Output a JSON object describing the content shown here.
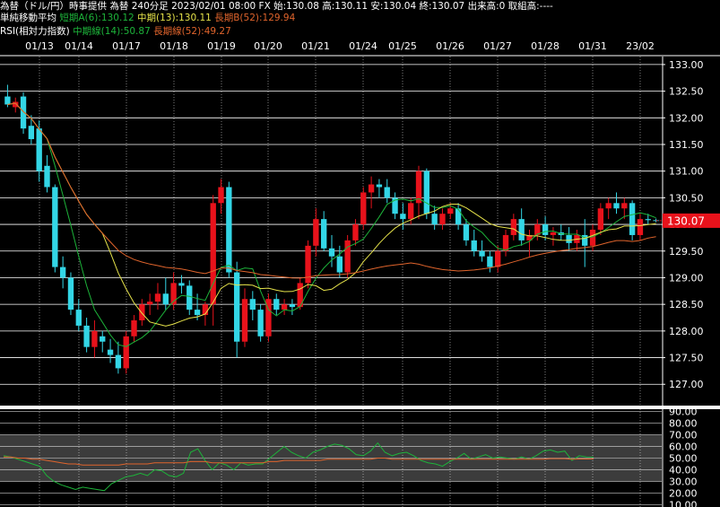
{
  "header": {
    "line1": "為替（ドル/円）時事提供 為替 240分足 2023/02/01 08:00 FX 始:130.08 高:130.11 安:130.04 終:130.07 出来高:0 取組高:----",
    "ma_title": "単純移動平均",
    "ma_short": "短期A(6):130.12",
    "ma_mid": "中期(13):130.11",
    "ma_long": "長期B(52):129.94",
    "rsi_title": "RSI(相対力指数)",
    "rsi_mid": "中期線(14):50.87",
    "rsi_long": "長期線(52):49.27"
  },
  "colors": {
    "background": "#000000",
    "up_candle": "#e8121b",
    "down_candle": "#33d6e6",
    "ma_short": "#1db43a",
    "ma_mid": "#e5e24a",
    "ma_long": "#e0642c",
    "price_badge": "#e8121b",
    "grid": "#ffffff",
    "rsi_band": "#3c3c3c"
  },
  "chart_data": [
    {
      "type": "candlestick",
      "x_tick_labels": [
        "01/13",
        "01/14",
        "01/17",
        "01/18",
        "01/19",
        "01/20",
        "01/21",
        "01/24",
        "01/25",
        "01/26",
        "01/27",
        "01/28",
        "01/31",
        "23/02"
      ],
      "y_tick_labels": [
        "133.00",
        "132.50",
        "132.00",
        "131.50",
        "131.00",
        "130.50",
        "130.00",
        "129.50",
        "129.00",
        "128.50",
        "128.00",
        "127.50",
        "127.00"
      ],
      "ylim": [
        126.6,
        133.15
      ],
      "last_price_label": "130.07",
      "candles": [
        {
          "o": 132.4,
          "h": 132.62,
          "l": 132.2,
          "c": 132.25
        },
        {
          "o": 132.2,
          "h": 132.38,
          "l": 132.1,
          "c": 132.3
        },
        {
          "o": 132.4,
          "h": 132.48,
          "l": 131.7,
          "c": 131.8
        },
        {
          "o": 131.85,
          "h": 132.05,
          "l": 131.5,
          "c": 131.6
        },
        {
          "o": 131.8,
          "h": 131.95,
          "l": 130.8,
          "c": 131.0
        },
        {
          "o": 131.1,
          "h": 131.3,
          "l": 130.6,
          "c": 130.7
        },
        {
          "o": 130.7,
          "h": 130.75,
          "l": 129.1,
          "c": 129.2
        },
        {
          "o": 129.2,
          "h": 129.4,
          "l": 128.8,
          "c": 129.0
        },
        {
          "o": 129.0,
          "h": 129.1,
          "l": 128.3,
          "c": 128.4
        },
        {
          "o": 128.4,
          "h": 128.6,
          "l": 128.0,
          "c": 128.1
        },
        {
          "o": 128.1,
          "h": 128.25,
          "l": 127.6,
          "c": 127.7
        },
        {
          "o": 127.7,
          "h": 128.2,
          "l": 127.5,
          "c": 128.0
        },
        {
          "o": 127.9,
          "h": 128.0,
          "l": 127.6,
          "c": 127.8
        },
        {
          "o": 127.65,
          "h": 127.85,
          "l": 127.4,
          "c": 127.55
        },
        {
          "o": 127.55,
          "h": 127.8,
          "l": 127.2,
          "c": 127.3
        },
        {
          "o": 127.3,
          "h": 128.0,
          "l": 127.2,
          "c": 127.9
        },
        {
          "o": 127.9,
          "h": 128.3,
          "l": 127.8,
          "c": 128.2
        },
        {
          "o": 128.2,
          "h": 128.6,
          "l": 128.1,
          "c": 128.5
        },
        {
          "o": 128.5,
          "h": 128.7,
          "l": 128.3,
          "c": 128.55
        },
        {
          "o": 128.55,
          "h": 128.9,
          "l": 128.4,
          "c": 128.7
        },
        {
          "o": 128.7,
          "h": 129.0,
          "l": 128.4,
          "c": 128.5
        },
        {
          "o": 128.5,
          "h": 129.1,
          "l": 128.4,
          "c": 128.9
        },
        {
          "o": 128.9,
          "h": 129.05,
          "l": 128.7,
          "c": 128.85
        },
        {
          "o": 128.85,
          "h": 128.95,
          "l": 128.3,
          "c": 128.4
        },
        {
          "o": 128.4,
          "h": 128.7,
          "l": 128.2,
          "c": 128.3
        },
        {
          "o": 128.3,
          "h": 128.55,
          "l": 128.1,
          "c": 128.5
        },
        {
          "o": 128.5,
          "h": 130.55,
          "l": 128.1,
          "c": 130.4
        },
        {
          "o": 130.4,
          "h": 130.85,
          "l": 130.2,
          "c": 130.7
        },
        {
          "o": 130.7,
          "h": 130.8,
          "l": 129.0,
          "c": 129.1
        },
        {
          "o": 129.1,
          "h": 129.3,
          "l": 127.5,
          "c": 127.8
        },
        {
          "o": 127.8,
          "h": 128.8,
          "l": 127.7,
          "c": 128.6
        },
        {
          "o": 128.6,
          "h": 128.75,
          "l": 128.2,
          "c": 128.4
        },
        {
          "o": 128.4,
          "h": 128.5,
          "l": 127.8,
          "c": 127.9
        },
        {
          "o": 127.9,
          "h": 128.7,
          "l": 127.8,
          "c": 128.6
        },
        {
          "o": 128.6,
          "h": 128.7,
          "l": 128.3,
          "c": 128.4
        },
        {
          "o": 128.4,
          "h": 128.6,
          "l": 128.3,
          "c": 128.5
        },
        {
          "o": 128.5,
          "h": 128.6,
          "l": 128.3,
          "c": 128.45
        },
        {
          "o": 128.45,
          "h": 129.0,
          "l": 128.4,
          "c": 128.9
        },
        {
          "o": 128.9,
          "h": 129.7,
          "l": 128.8,
          "c": 129.6
        },
        {
          "o": 129.6,
          "h": 130.3,
          "l": 129.4,
          "c": 130.1
        },
        {
          "o": 130.1,
          "h": 130.25,
          "l": 129.5,
          "c": 129.55
        },
        {
          "o": 129.55,
          "h": 129.8,
          "l": 129.2,
          "c": 129.4
        },
        {
          "o": 129.4,
          "h": 129.6,
          "l": 129.0,
          "c": 129.1
        },
        {
          "o": 129.1,
          "h": 129.8,
          "l": 129.0,
          "c": 129.7
        },
        {
          "o": 129.7,
          "h": 130.1,
          "l": 129.6,
          "c": 130.0
        },
        {
          "o": 130.0,
          "h": 130.7,
          "l": 129.9,
          "c": 130.6
        },
        {
          "o": 130.6,
          "h": 130.9,
          "l": 130.3,
          "c": 130.75
        },
        {
          "o": 130.75,
          "h": 130.85,
          "l": 130.5,
          "c": 130.7
        },
        {
          "o": 130.7,
          "h": 130.85,
          "l": 130.4,
          "c": 130.5
        },
        {
          "o": 130.5,
          "h": 130.6,
          "l": 130.1,
          "c": 130.2
        },
        {
          "o": 130.2,
          "h": 130.4,
          "l": 129.9,
          "c": 130.1
        },
        {
          "o": 130.1,
          "h": 130.5,
          "l": 130.0,
          "c": 130.4
        },
        {
          "o": 130.4,
          "h": 131.1,
          "l": 130.1,
          "c": 131.0
        },
        {
          "o": 131.0,
          "h": 131.05,
          "l": 130.1,
          "c": 130.2
        },
        {
          "o": 130.2,
          "h": 130.35,
          "l": 129.9,
          "c": 130.0
        },
        {
          "o": 130.0,
          "h": 130.3,
          "l": 129.9,
          "c": 130.2
        },
        {
          "o": 130.2,
          "h": 130.4,
          "l": 130.1,
          "c": 130.3
        },
        {
          "o": 130.3,
          "h": 130.4,
          "l": 129.9,
          "c": 130.0
        },
        {
          "o": 130.0,
          "h": 130.1,
          "l": 129.6,
          "c": 129.7
        },
        {
          "o": 129.7,
          "h": 129.9,
          "l": 129.4,
          "c": 129.5
        },
        {
          "o": 129.5,
          "h": 129.7,
          "l": 129.3,
          "c": 129.4
        },
        {
          "o": 129.4,
          "h": 129.5,
          "l": 129.1,
          "c": 129.2
        },
        {
          "o": 129.2,
          "h": 129.6,
          "l": 129.1,
          "c": 129.5
        },
        {
          "o": 129.5,
          "h": 129.9,
          "l": 129.4,
          "c": 129.8
        },
        {
          "o": 129.8,
          "h": 130.2,
          "l": 129.7,
          "c": 130.1
        },
        {
          "o": 130.1,
          "h": 130.3,
          "l": 129.6,
          "c": 129.7
        },
        {
          "o": 129.7,
          "h": 129.9,
          "l": 129.4,
          "c": 129.8
        },
        {
          "o": 129.8,
          "h": 130.1,
          "l": 129.7,
          "c": 130.0
        },
        {
          "o": 130.0,
          "h": 130.15,
          "l": 129.7,
          "c": 129.8
        },
        {
          "o": 129.8,
          "h": 129.95,
          "l": 129.6,
          "c": 129.85
        },
        {
          "o": 129.85,
          "h": 130.0,
          "l": 129.7,
          "c": 129.8
        },
        {
          "o": 129.8,
          "h": 129.95,
          "l": 129.5,
          "c": 129.65
        },
        {
          "o": 129.65,
          "h": 129.9,
          "l": 129.5,
          "c": 129.8
        },
        {
          "o": 129.8,
          "h": 130.1,
          "l": 129.2,
          "c": 129.6
        },
        {
          "o": 129.6,
          "h": 130.0,
          "l": 129.5,
          "c": 129.9
        },
        {
          "o": 129.9,
          "h": 130.4,
          "l": 129.8,
          "c": 130.3
        },
        {
          "o": 130.3,
          "h": 130.5,
          "l": 130.1,
          "c": 130.4
        },
        {
          "o": 130.4,
          "h": 130.6,
          "l": 130.2,
          "c": 130.3
        },
        {
          "o": 130.3,
          "h": 130.5,
          "l": 130.1,
          "c": 130.4
        },
        {
          "o": 130.4,
          "h": 130.45,
          "l": 129.7,
          "c": 129.8
        },
        {
          "o": 129.8,
          "h": 130.2,
          "l": 129.7,
          "c": 130.1
        },
        {
          "o": 130.1,
          "h": 130.2,
          "l": 130.0,
          "c": 130.08
        },
        {
          "o": 130.08,
          "h": 130.11,
          "l": 130.04,
          "c": 130.07
        }
      ],
      "ma_periods": [
        6,
        13,
        52
      ]
    },
    {
      "type": "line",
      "y_tick_labels": [
        "90.00",
        "80.00",
        "70.00",
        "60.00",
        "50.00",
        "40.00",
        "30.00",
        "20.00",
        "10.00"
      ],
      "ylim": [
        8,
        92
      ],
      "highlight_band": [
        30,
        70
      ],
      "series": [
        {
          "name": "中期線(14)",
          "values": [
            52,
            51,
            49,
            47,
            45,
            43,
            35,
            30,
            27,
            25,
            23,
            25,
            24,
            23,
            22,
            28,
            31,
            34,
            35,
            37,
            35,
            40,
            39,
            35,
            34,
            37,
            55,
            58,
            48,
            40,
            46,
            44,
            40,
            46,
            44,
            45,
            45,
            50,
            55,
            60,
            55,
            52,
            50,
            55,
            57,
            60,
            62,
            61,
            58,
            53,
            52,
            56,
            63,
            55,
            52,
            54,
            55,
            52,
            48,
            46,
            45,
            43,
            47,
            50,
            54,
            49,
            51,
            53,
            50,
            51,
            50,
            49,
            51,
            49,
            52,
            56,
            57,
            55,
            56,
            48,
            52,
            51,
            50.87
          ]
        },
        {
          "name": "長期線(52)",
          "values": [
            51,
            51,
            50,
            50,
            49,
            49,
            48,
            47,
            46,
            45,
            45,
            44,
            44,
            44,
            44,
            44,
            44,
            45,
            45,
            45,
            45,
            46,
            46,
            46,
            46,
            46,
            47,
            47,
            47,
            46,
            46,
            46,
            46,
            46,
            46,
            46,
            46,
            47,
            47,
            48,
            48,
            48,
            48,
            48,
            48,
            49,
            49,
            49,
            49,
            49,
            49,
            49,
            50,
            50,
            49,
            49,
            49,
            49,
            49,
            49,
            49,
            49,
            49,
            49,
            49,
            49,
            49,
            49,
            49,
            49,
            49,
            49,
            49,
            49,
            49,
            49,
            49.5,
            49.5,
            49.5,
            49,
            49.2,
            49.2,
            49.27
          ]
        }
      ]
    }
  ]
}
